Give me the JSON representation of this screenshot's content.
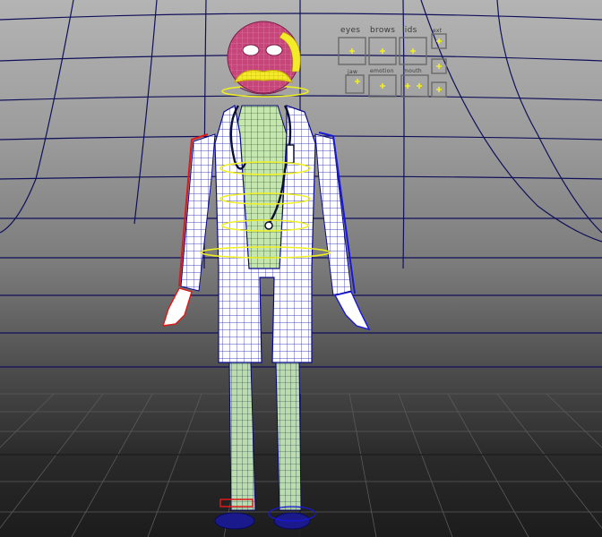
{
  "viewport": {
    "name": "3D perspective viewport"
  },
  "face_controls": {
    "eyes_label": "eyes",
    "brows_label": "brows",
    "lids_label": "lids",
    "emotion_label": "emotion",
    "jaw_label": "jaw",
    "mouth_label": "mouth",
    "ext_label": "ext"
  },
  "colors": {
    "head": "#c8457a",
    "mustache": "#f3ea2a",
    "coat": "#ffffff",
    "shirt": "#bfe0a8",
    "wire_blue": "#0a0a8a",
    "selected_red": "#e01818",
    "control_yellow": "#f0f020",
    "grid": "#10105a"
  },
  "icons": {
    "character": "character-wireframe",
    "face_panel": "face-control-panel"
  }
}
